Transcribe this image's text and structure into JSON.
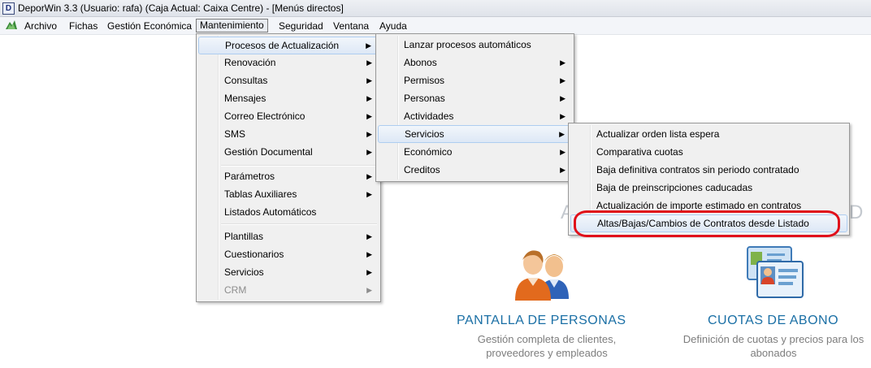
{
  "window": {
    "title": "DeporWin 3.3  (Usuario: rafa)  (Caja Actual: Caixa Centre) - [Menús directos]",
    "app_icon_letter": "D"
  },
  "menubar": {
    "items": [
      "Archivo",
      "Fichas",
      "Gestión Económica",
      "Mantenimiento",
      "Seguridad",
      "Ventana",
      "Ayuda"
    ],
    "active": "Mantenimiento"
  },
  "mantenimiento_menu": {
    "items": [
      {
        "label": "Procesos de Actualización",
        "submenu": true,
        "highlighted": true
      },
      {
        "label": "Renovación",
        "submenu": true
      },
      {
        "label": "Consultas",
        "submenu": true
      },
      {
        "label": "Mensajes",
        "submenu": true
      },
      {
        "label": "Correo Electrónico",
        "submenu": true
      },
      {
        "label": "SMS",
        "submenu": true
      },
      {
        "label": "Gestión Documental",
        "submenu": true
      },
      {
        "label": "Parámetros",
        "submenu": true
      },
      {
        "label": "Tablas Auxiliares",
        "submenu": true
      },
      {
        "label": "Listados Automáticos",
        "submenu": false
      },
      {
        "label": "Plantillas",
        "submenu": true
      },
      {
        "label": "Cuestionarios",
        "submenu": true
      },
      {
        "label": "Servicios",
        "submenu": true
      },
      {
        "label": "CRM",
        "submenu": true,
        "disabled": true
      }
    ]
  },
  "procesos_menu": {
    "items": [
      {
        "label": "Lanzar procesos automáticos",
        "submenu": false
      },
      {
        "label": "Abonos",
        "submenu": true
      },
      {
        "label": "Permisos",
        "submenu": true
      },
      {
        "label": "Personas",
        "submenu": true
      },
      {
        "label": "Actividades",
        "submenu": true
      },
      {
        "label": "Servicios",
        "submenu": true,
        "highlighted": true
      },
      {
        "label": "Económico",
        "submenu": true
      },
      {
        "label": "Creditos",
        "submenu": true
      }
    ]
  },
  "servicios_menu": {
    "items": [
      {
        "label": "Actualizar orden lista espera"
      },
      {
        "label": "Comparativa cuotas"
      },
      {
        "label": "Baja definitiva contratos sin periodo contratado"
      },
      {
        "label": "Baja de preinscripciones caducadas"
      },
      {
        "label": "Actualización de importe estimado en contratos"
      },
      {
        "label": "Altas/Bajas/Cambios de Contratos desde Listado",
        "highlighted": true
      }
    ]
  },
  "annotation": {
    "color": "#e0101a"
  },
  "dashboard": {
    "heading_fragment_left": "A",
    "heading_fragment_right": "D",
    "tiles": [
      {
        "title": "PANTALLA DE PERSONAS",
        "desc_line1": "Gestión completa de clientes,",
        "desc_line2": "proveedores y empleados",
        "icon": "people-icon"
      },
      {
        "title": "CUOTAS DE ABONO",
        "desc_line1": "Definición de cuotas y precios para los",
        "desc_line2": "abonados",
        "icon": "id-cards-icon"
      }
    ]
  },
  "colors": {
    "tile_title": "#1a6fa5",
    "tile_desc": "#7d7d7d",
    "menu_bg": "#f0f0f0",
    "highlight_border": "#aecdf0"
  }
}
